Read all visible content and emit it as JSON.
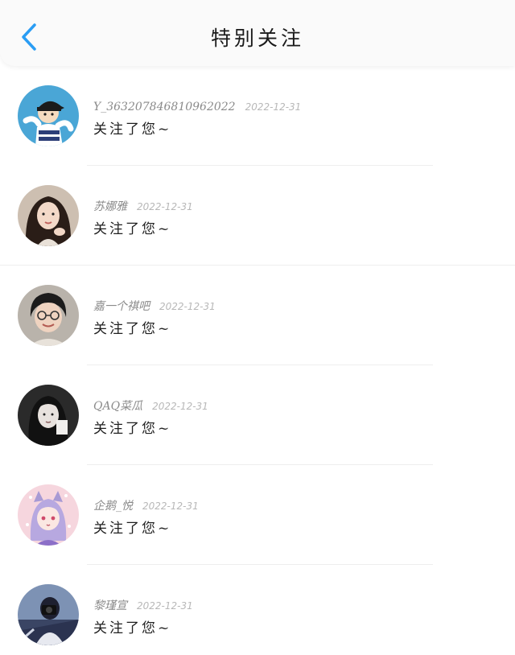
{
  "header": {
    "title": "特别关注",
    "back_icon": "chevron-left-icon",
    "accent_color": "#2a9df4"
  },
  "notifications": [
    {
      "username": "Y_363207846810962022",
      "date": "2022-12-31",
      "message": "关注了您~",
      "avatar": "cartoon-boy-cap"
    },
    {
      "username": "苏娜雅",
      "date": "2022-12-31",
      "message": "关注了您~",
      "avatar": "girl-long-hair"
    },
    {
      "username": "嘉一个祺吧",
      "date": "2022-12-31",
      "message": "关注了您~",
      "avatar": "boy-glasses"
    },
    {
      "username": "QAQ菜瓜",
      "date": "2022-12-31",
      "message": "关注了您~",
      "avatar": "girl-dark"
    },
    {
      "username": "企鹅_悦",
      "date": "2022-12-31",
      "message": "关注了您~",
      "avatar": "anime-girl-pink"
    },
    {
      "username": "黎瑾宣",
      "date": "2022-12-31",
      "message": "关注了您~",
      "avatar": "person-camera"
    }
  ]
}
